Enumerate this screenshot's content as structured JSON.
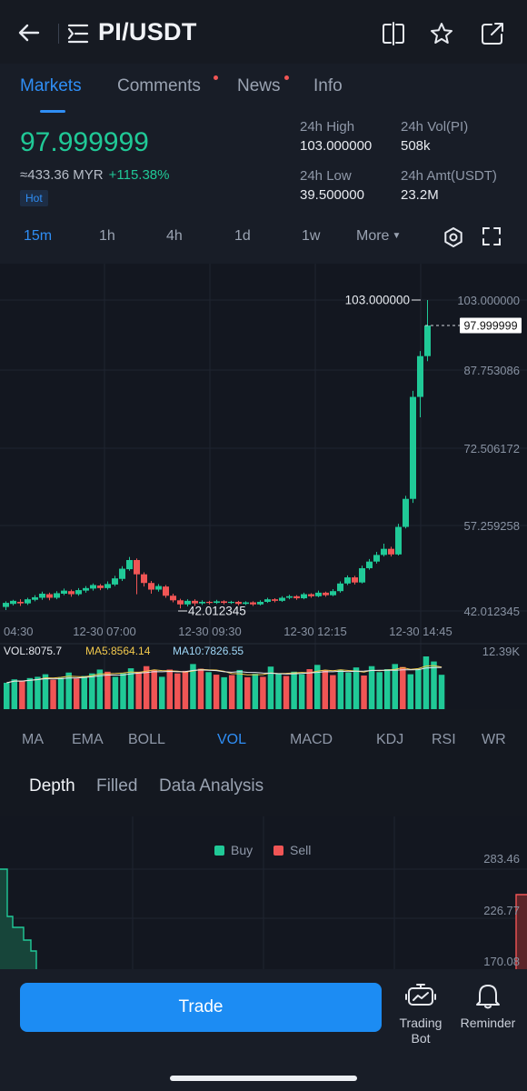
{
  "header": {
    "pair": "PI/USDT",
    "icons": [
      "back-arrow-icon",
      "list-toggle-icon",
      "split-view-icon",
      "star-icon",
      "share-icon"
    ]
  },
  "tabs": [
    {
      "label": "Markets",
      "active": true,
      "dot": false
    },
    {
      "label": "Comments",
      "active": false,
      "dot": true
    },
    {
      "label": "News",
      "active": false,
      "dot": true
    },
    {
      "label": "Info",
      "active": false,
      "dot": false
    }
  ],
  "ticker": {
    "price": "97.999999",
    "converted": "≈433.36 MYR",
    "change": "+115.38%",
    "badge": "Hot",
    "high_label": "24h High",
    "high_value": "103.000000",
    "vol_label": "24h Vol(PI)",
    "vol_value": "508k",
    "low_label": "24h Low",
    "low_value": "39.500000",
    "amt_label": "24h Amt(USDT)",
    "amt_value": "23.2M"
  },
  "timeframes": [
    {
      "label": "15m",
      "active": true
    },
    {
      "label": "1h",
      "active": false
    },
    {
      "label": "4h",
      "active": false
    },
    {
      "label": "1d",
      "active": false
    },
    {
      "label": "1w",
      "active": false
    },
    {
      "label": "More",
      "active": false
    }
  ],
  "chart_data": {
    "type": "candlestick",
    "y_ticks": [
      "103.000000",
      "87.753086",
      "72.506172",
      "57.259258",
      "42.012345"
    ],
    "ylim": [
      42.012345,
      103.0
    ],
    "x_ticks": [
      "04:30",
      "12-30 07:00",
      "12-30 09:30",
      "12-30 12:15",
      "12-30 14:45"
    ],
    "last_price_label": "97.999999",
    "last_price": 97.999999,
    "max_label": "103.000000",
    "max_value": 103.0,
    "min_label": "42.012345",
    "min_value": 42.012345,
    "candles": [
      [
        42.8,
        43.6,
        42.2,
        43.9
      ],
      [
        43.4,
        44.0,
        43.1,
        44.2
      ],
      [
        43.8,
        43.5,
        43.0,
        44.3
      ],
      [
        43.5,
        44.3,
        43.2,
        44.6
      ],
      [
        44.2,
        44.7,
        43.9,
        45.1
      ],
      [
        44.6,
        45.4,
        44.2,
        45.8
      ],
      [
        45.3,
        44.6,
        44.1,
        45.6
      ],
      [
        44.6,
        45.5,
        44.3,
        45.9
      ],
      [
        45.4,
        46.0,
        45.1,
        46.4
      ],
      [
        45.9,
        45.3,
        44.8,
        46.2
      ],
      [
        45.3,
        46.1,
        45.0,
        46.5
      ],
      [
        46.0,
        46.5,
        45.6,
        46.9
      ],
      [
        46.4,
        47.1,
        46.0,
        47.4
      ],
      [
        47.0,
        46.5,
        46.1,
        47.3
      ],
      [
        46.5,
        47.3,
        46.2,
        47.8
      ],
      [
        47.2,
        48.4,
        46.9,
        48.9
      ],
      [
        48.3,
        50.3,
        47.9,
        50.8
      ],
      [
        50.2,
        52.0,
        49.9,
        52.6
      ],
      [
        52.0,
        49.2,
        45.3,
        52.3
      ],
      [
        49.2,
        47.5,
        46.8,
        49.6
      ],
      [
        47.5,
        46.2,
        45.4,
        47.9
      ],
      [
        46.2,
        46.9,
        45.8,
        47.3
      ],
      [
        46.8,
        45.0,
        44.6,
        47.1
      ],
      [
        45.0,
        44.1,
        43.7,
        45.4
      ],
      [
        44.1,
        43.3,
        42.5,
        44.4
      ],
      [
        43.3,
        44.0,
        42.9,
        44.3
      ],
      [
        44.0,
        43.5,
        43.0,
        44.3
      ],
      [
        43.5,
        43.8,
        43.2,
        44.1
      ],
      [
        43.8,
        43.6,
        43.3,
        44.0
      ],
      [
        43.6,
        43.9,
        43.4,
        44.2
      ],
      [
        43.9,
        43.6,
        43.3,
        44.1
      ],
      [
        43.6,
        43.8,
        43.4,
        44.0
      ],
      [
        43.8,
        43.4,
        43.1,
        44.0
      ],
      [
        43.4,
        43.7,
        43.2,
        43.9
      ],
      [
        43.7,
        43.3,
        43.0,
        43.9
      ],
      [
        43.3,
        43.8,
        43.1,
        44.1
      ],
      [
        43.8,
        44.3,
        43.6,
        44.6
      ],
      [
        44.3,
        44.0,
        43.7,
        44.5
      ],
      [
        44.0,
        44.6,
        43.8,
        44.9
      ],
      [
        44.6,
        44.9,
        44.3,
        45.2
      ],
      [
        44.9,
        44.5,
        44.2,
        45.1
      ],
      [
        44.5,
        45.3,
        44.3,
        45.6
      ],
      [
        45.3,
        44.9,
        44.6,
        45.5
      ],
      [
        44.9,
        45.6,
        44.7,
        46.0
      ],
      [
        45.6,
        45.1,
        44.8,
        45.8
      ],
      [
        45.1,
        45.9,
        44.9,
        46.3
      ],
      [
        45.9,
        47.4,
        45.6,
        47.8
      ],
      [
        47.4,
        48.6,
        47.1,
        49.0
      ],
      [
        48.6,
        47.6,
        47.2,
        48.9
      ],
      [
        47.6,
        50.4,
        47.4,
        50.9
      ],
      [
        50.4,
        51.7,
        50.1,
        52.2
      ],
      [
        51.7,
        53.0,
        51.3,
        53.6
      ],
      [
        53.0,
        54.2,
        52.7,
        55.2
      ],
      [
        54.2,
        53.1,
        52.7,
        54.6
      ],
      [
        53.1,
        58.5,
        52.9,
        59.1
      ],
      [
        58.5,
        64.0,
        58.2,
        64.6
      ],
      [
        64.0,
        84.0,
        63.2,
        85.2
      ],
      [
        84.0,
        92.0,
        80.0,
        93.0
      ],
      [
        92.0,
        98.0,
        91.0,
        103.0
      ]
    ],
    "volume": {
      "ylim_label": "12.39K",
      "ymax": 12390,
      "vol_label": "VOL:8075.7",
      "ma5_label": "MA5:8564.14",
      "ma10_label": "MA10:7826.55",
      "values": [
        6200,
        7000,
        6600,
        7300,
        7600,
        8200,
        6900,
        7400,
        8600,
        7200,
        7800,
        8400,
        9300,
        8800,
        7600,
        8400,
        9600,
        8800,
        10100,
        9200,
        7600,
        9300,
        8400,
        9000,
        10600,
        9500,
        8700,
        8100,
        7500,
        8000,
        9200,
        7500,
        8300,
        7600,
        10000,
        8400,
        7800,
        8800,
        8200,
        9400,
        10400,
        9100,
        8000,
        9300,
        8600,
        9800,
        7900,
        10100,
        8700,
        9400,
        10600,
        9900,
        8200,
        9500,
        12390,
        11200,
        8075.7
      ]
    }
  },
  "indicators": [
    {
      "label": "MA",
      "active": false
    },
    {
      "label": "EMA",
      "active": false
    },
    {
      "label": "BOLL",
      "active": false
    },
    {
      "label": "VOL",
      "active": true
    },
    {
      "label": "MACD",
      "active": false
    },
    {
      "label": "KDJ",
      "active": false
    },
    {
      "label": "RSI",
      "active": false
    },
    {
      "label": "WR",
      "active": false
    }
  ],
  "depth_tabs": [
    {
      "label": "Depth",
      "active": true
    },
    {
      "label": "Filled",
      "active": false
    },
    {
      "label": "Data Analysis",
      "active": false
    }
  ],
  "depth": {
    "legend_buy": "Buy",
    "legend_sell": "Sell",
    "y_ticks": [
      "283.46",
      "226.77",
      "170.08"
    ]
  },
  "bottom_bar": {
    "trade_label": "Trade",
    "bot_label_1": "Trading",
    "bot_label_2": "Bot",
    "reminder_label": "Reminder"
  },
  "colors": {
    "accent": "#2f8ef5",
    "up": "#20c997",
    "down": "#f05555",
    "background": "#141820"
  }
}
